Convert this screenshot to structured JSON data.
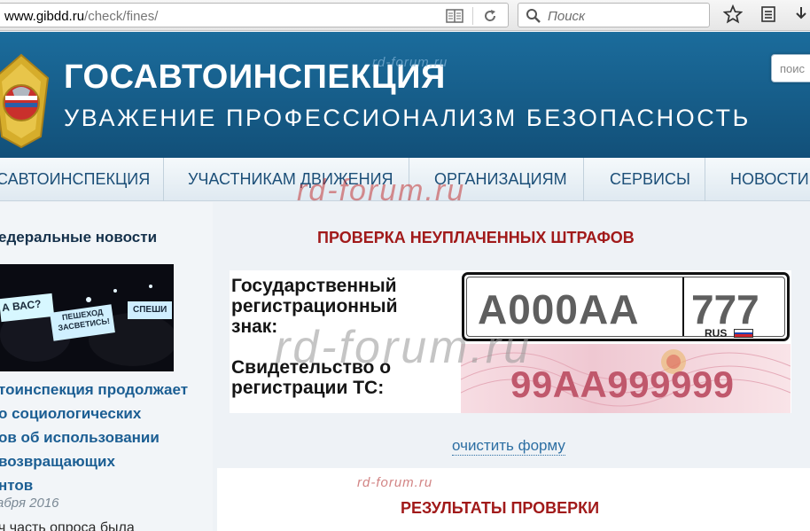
{
  "browser": {
    "url_domain": "www.gibdd.ru",
    "url_path": "/check/fines/",
    "search_placeholder": "Поиск"
  },
  "header": {
    "title": "ГОСАВТОИНСПЕКЦИЯ",
    "slogan": "УВАЖЕНИЕ ПРОФЕССИОНАЛИЗМ БЕЗОПАСНОСТЬ",
    "search_placeholder": "поис"
  },
  "nav": {
    "items": [
      {
        "label": "САВТОИНСПЕКЦИЯ"
      },
      {
        "label": "УЧАСТНИКАМ ДВИЖЕНИЯ"
      },
      {
        "label": "ОРГАНИЗАЦИЯМ"
      },
      {
        "label": "СЕРВИСЫ"
      },
      {
        "label": "НОВОСТИ"
      }
    ]
  },
  "sidebar": {
    "title": "едеральные новости",
    "image_text_1": "А ВАС?",
    "image_text_2": "ПЕШЕХОД ЗАСВЕТИСЬ!",
    "image_text_3": "СПЕШИ",
    "headline": "тоинспекция продолжает\nо социологических\nов об использовании\nвозвращающих\nнтов",
    "date": "абря 2016",
    "cut_text": "ч часть опроса была"
  },
  "main": {
    "form_title": "ПРОВЕРКА НЕУПЛАЧЕННЫХ ШТРАФОВ",
    "plate_label": "Государственный\nрегистрационный\nзнак:",
    "plate_number": "А000АА",
    "plate_region": "777",
    "plate_country": "RUS",
    "cert_label": "Свидетельство о\nрегистрации ТС:",
    "cert_number": "99АА999999",
    "clear_link": "очистить форму",
    "results_title": "РЕЗУЛЬТАТЫ ПРОВЕРКИ"
  },
  "watermark": "rd-forum.ru",
  "colors": {
    "header_blue": "#1b6c9c",
    "title_red": "#a11a1a",
    "link_blue": "#2d6fa3"
  }
}
